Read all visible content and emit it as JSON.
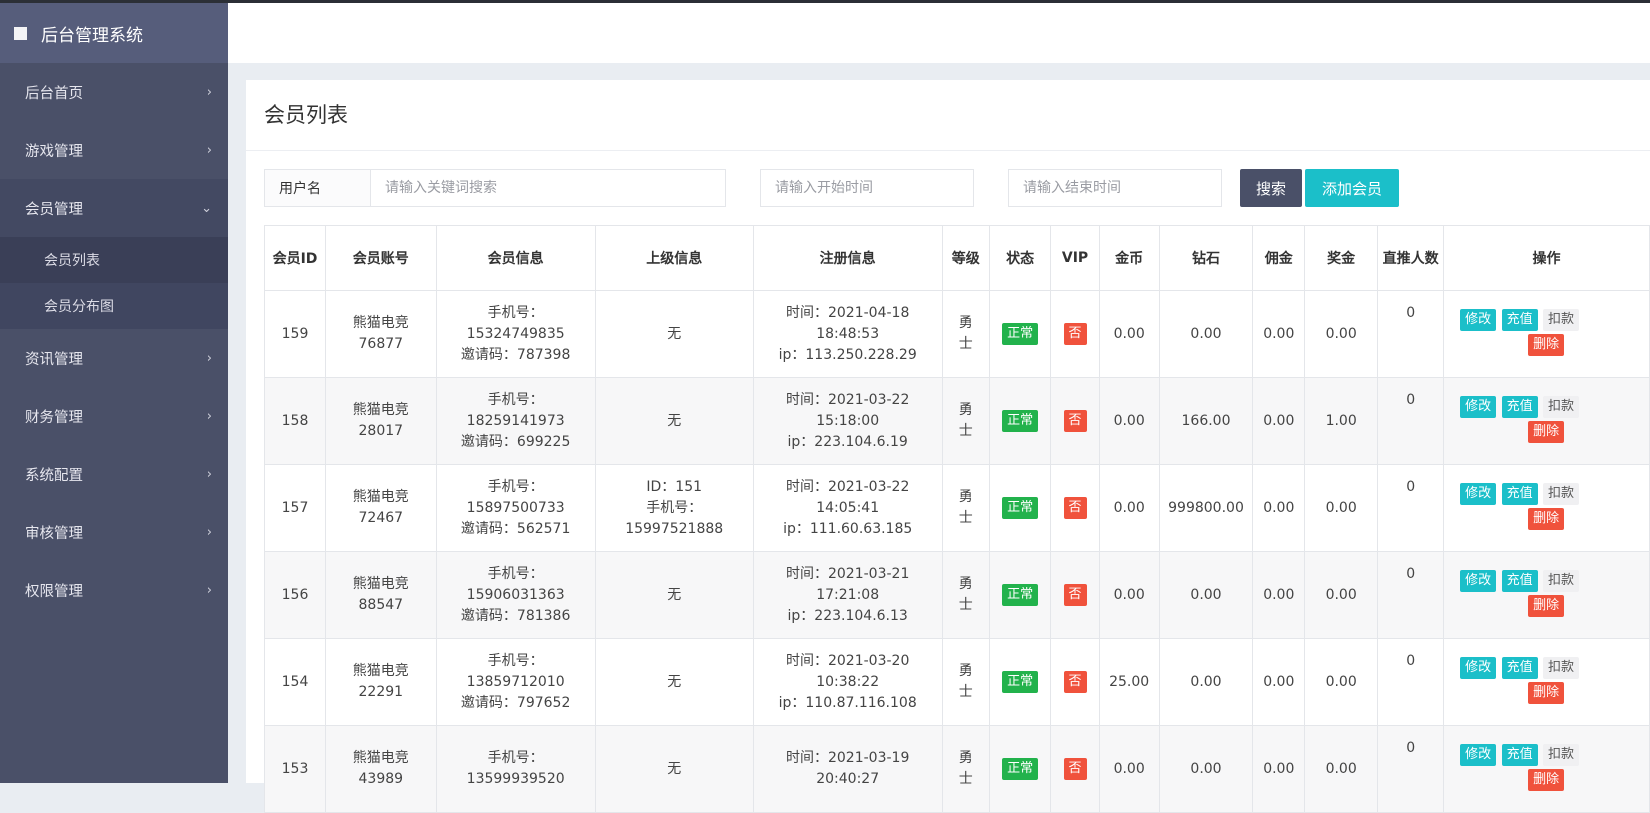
{
  "sidebar": {
    "brand": "后台管理系统",
    "menu": [
      {
        "label": "后台首页"
      },
      {
        "label": "游戏管理"
      },
      {
        "label": "会员管理"
      },
      {
        "label": "资讯管理"
      },
      {
        "label": "财务管理"
      },
      {
        "label": "系统配置"
      },
      {
        "label": "审核管理"
      },
      {
        "label": "权限管理"
      }
    ],
    "submenu": [
      {
        "label": "会员列表"
      },
      {
        "label": "会员分布图"
      }
    ]
  },
  "panel": {
    "title": "会员列表"
  },
  "filters": {
    "label": "用户名",
    "keyword_placeholder": "请输入关键词搜索",
    "start_placeholder": "请输入开始时间",
    "end_placeholder": "请输入结束时间",
    "search_label": "搜索",
    "add_label": "添加会员"
  },
  "table": {
    "headers": {
      "id_1": "会员",
      "id_2": "ID",
      "account": "会员账号",
      "info": "会员信息",
      "parent": "上级信息",
      "register": "注册信息",
      "level_1": "等",
      "level_2": "级",
      "status": "状态",
      "vip": "VIP",
      "gold": "金币",
      "diamond": "钻石",
      "commission_1": "佣",
      "commission_2": "金",
      "bonus": "奖金",
      "recommend_1": "直推人",
      "recommend_2": "数",
      "ops": "操作"
    },
    "ops": {
      "edit": "修改",
      "charge": "充值",
      "deduct": "扣款",
      "delete": "删除"
    },
    "rows": [
      {
        "id": "159",
        "account_1": "熊猫电竞",
        "account_2": "76877",
        "phone_label": "手机号：",
        "phone": "15324749835",
        "invite": "邀请码：787398",
        "parent_1": "无",
        "parent_2": "",
        "time_label": "时间：2021-04-18",
        "time": "18:48:53",
        "ip": "ip：113.250.228.29",
        "level_1": "勇",
        "level_2": "士",
        "status": "正常",
        "vip": "否",
        "gold": "0.00",
        "diamond": "0.00",
        "commission": "0.00",
        "bonus": "0.00",
        "recommend": "0"
      },
      {
        "id": "158",
        "account_1": "熊猫电竞",
        "account_2": "28017",
        "phone_label": "手机号：",
        "phone": "18259141973",
        "invite": "邀请码：699225",
        "parent_1": "无",
        "parent_2": "",
        "time_label": "时间：2021-03-22",
        "time": "15:18:00",
        "ip": "ip：223.104.6.19",
        "level_1": "勇",
        "level_2": "士",
        "status": "正常",
        "vip": "否",
        "gold": "0.00",
        "diamond": "166.00",
        "commission": "0.00",
        "bonus": "1.00",
        "recommend": "0"
      },
      {
        "id": "157",
        "account_1": "熊猫电竞",
        "account_2": "72467",
        "phone_label": "手机号：",
        "phone": "15897500733",
        "invite": "邀请码：562571",
        "parent_1": "ID：151",
        "parent_2": "手机号：",
        "parent_3": "15997521888",
        "time_label": "时间：2021-03-22",
        "time": "14:05:41",
        "ip": "ip：111.60.63.185",
        "level_1": "勇",
        "level_2": "士",
        "status": "正常",
        "vip": "否",
        "gold": "0.00",
        "diamond": "999800.00",
        "commission": "0.00",
        "bonus": "0.00",
        "recommend": "0"
      },
      {
        "id": "156",
        "account_1": "熊猫电竞",
        "account_2": "88547",
        "phone_label": "手机号：",
        "phone": "15906031363",
        "invite": "邀请码：781386",
        "parent_1": "无",
        "parent_2": "",
        "time_label": "时间：2021-03-21",
        "time": "17:21:08",
        "ip": "ip：223.104.6.13",
        "level_1": "勇",
        "level_2": "士",
        "status": "正常",
        "vip": "否",
        "gold": "0.00",
        "diamond": "0.00",
        "commission": "0.00",
        "bonus": "0.00",
        "recommend": "0"
      },
      {
        "id": "154",
        "account_1": "熊猫电竞",
        "account_2": "22291",
        "phone_label": "手机号：",
        "phone": "13859712010",
        "invite": "邀请码：797652",
        "parent_1": "无",
        "parent_2": "",
        "time_label": "时间：2021-03-20",
        "time": "10:38:22",
        "ip": "ip：110.87.116.108",
        "level_1": "勇",
        "level_2": "士",
        "status": "正常",
        "vip": "否",
        "gold": "25.00",
        "diamond": "0.00",
        "commission": "0.00",
        "bonus": "0.00",
        "recommend": "0"
      },
      {
        "id": "153",
        "account_1": "熊猫电竞",
        "account_2": "43989",
        "phone_label": "手机号：",
        "phone": "13599939520",
        "invite": "",
        "parent_1": "无",
        "parent_2": "",
        "time_label": "时间：2021-03-19",
        "time": "20:40:27",
        "ip": "",
        "level_1": "勇",
        "level_2": "士",
        "status": "正常",
        "vip": "否",
        "gold": "0.00",
        "diamond": "0.00",
        "commission": "0.00",
        "bonus": "0.00",
        "recommend": "0"
      }
    ]
  },
  "colors": {
    "sidebar_bg": "#4a5068",
    "accent": "#1bbfc9",
    "danger": "#f0523c",
    "success": "#22b24c"
  }
}
